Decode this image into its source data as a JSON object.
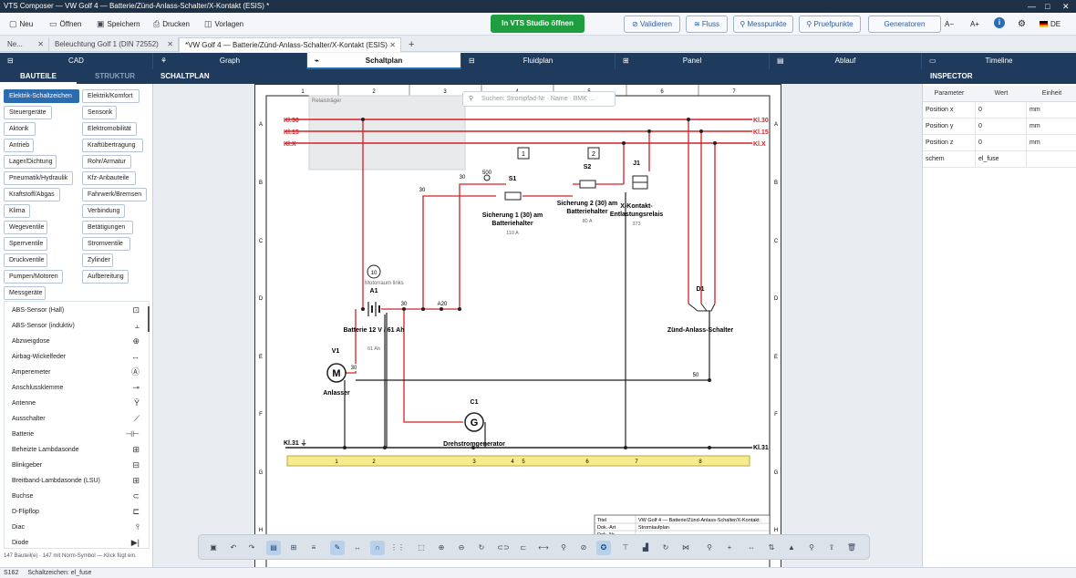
{
  "window": {
    "title": "VTS Composer — VW Golf 4 — Batterie/Zünd-Anlass-Schalter/X-Kontakt (ESIS) *",
    "minimize": "—",
    "maximize": "□",
    "close": "✕"
  },
  "menu": {
    "new_label": "Neu",
    "open_label": "Öffnen",
    "save_label": "Speichern",
    "print_label": "Drucken",
    "templates_label": "Vorlagen",
    "open_in_studio": "In VTS Studio öffnen",
    "validate_label": "Validieren",
    "flow_label": "Fluss",
    "measure_label": "Messpunkte",
    "check_label": "Pruefpunkte",
    "generators_label": "Generatoren",
    "font_down": "A−",
    "font_up": "A+",
    "info": "i",
    "settings": "⚙",
    "language": "DE"
  },
  "doc_tabs": [
    {
      "label": "Ne...",
      "close": "✕"
    },
    {
      "label": "Beleuchtung Golf 1 (DIN 72552)",
      "close": "✕"
    },
    {
      "label": "*VW Golf 4 — Batterie/Zünd-Anlass-Schalter/X-Kontakt (ESIS)",
      "close": "✕"
    },
    {
      "label": "+"
    }
  ],
  "sections": {
    "cad": "CAD",
    "graph": "Graph",
    "schaltplan": "Schaltplan",
    "fluidplan": "Fluidplan",
    "panel": "Panel",
    "ablauf": "Ablauf",
    "timeline": "Timeline"
  },
  "subheader": {
    "bauteile": "BAUTEILE",
    "struktur": "STRUKTUR",
    "schaltplan": "SCHALTPLAN",
    "inspector": "INSPECTOR"
  },
  "categories": [
    "Elektrik-Schaltzeichen",
    "Elektrik/Komfort",
    "Steuergeräte",
    "Sensorik",
    "Aktorik",
    "Elektromobilität",
    "Antrieb",
    "Kraftübertragung",
    "Lager/Dichtung",
    "Rohr/Armatur",
    "Pneumatik/Hydraulik",
    "Kfz-Anbauteile",
    "Kraftstoff/Abgas",
    "Fahrwerk/Bremsen",
    "Klima",
    "Verbindung",
    "Wegeventile",
    "Betätigungen",
    "Sperrventile",
    "Stromventile",
    "Druckventile",
    "Zylinder",
    "Pumpen/Motoren",
    "Aufbereitung",
    "Messgeräte"
  ],
  "components": [
    {
      "name": "ABS-Sensor (Hall)",
      "icon": "abs-hall-icon"
    },
    {
      "name": "ABS-Sensor (induktiv)",
      "icon": "abs-inductive-icon"
    },
    {
      "name": "Abzweigdose",
      "icon": "junction-box-icon"
    },
    {
      "name": "Airbag-Wickelfeder",
      "icon": "clockspring-icon"
    },
    {
      "name": "Amperemeter",
      "icon": "ammeter-icon"
    },
    {
      "name": "Anschlussklemme",
      "icon": "terminal-icon"
    },
    {
      "name": "Antenne",
      "icon": "antenna-icon"
    },
    {
      "name": "Ausschalter",
      "icon": "switch-icon"
    },
    {
      "name": "Batterie",
      "icon": "battery-icon"
    },
    {
      "name": "Beheizte Lambdasonde",
      "icon": "lambda-heated-icon"
    },
    {
      "name": "Blinkgeber",
      "icon": "flasher-icon"
    },
    {
      "name": "Breitband-Lambdasonde (LSU)",
      "icon": "lambda-lsu-icon"
    },
    {
      "name": "Buchse",
      "icon": "socket-icon"
    },
    {
      "name": "D-Flipflop",
      "icon": "flipflop-icon"
    },
    {
      "name": "Diac",
      "icon": "diac-icon"
    },
    {
      "name": "Diode",
      "icon": "diode-icon"
    }
  ],
  "left_footer": "147 Bauteil(e) · 147 mit Norm-Symbol — Klick fügt ein.",
  "search_placeholder": "Suchen: Strompfad-Nr · Name · BMK ...",
  "schematic": {
    "columns": [
      "1",
      "2",
      "3",
      "4",
      "5",
      "6",
      "7"
    ],
    "rows": [
      "A",
      "B",
      "C",
      "D",
      "E",
      "F",
      "G",
      "H"
    ],
    "rails": [
      {
        "label": "Kl.30"
      },
      {
        "label": "Kl.15"
      },
      {
        "label": "Kl.X"
      },
      {
        "label": "Kl.31"
      }
    ],
    "relais_label": "Relaisträger",
    "boxes": [
      "1",
      "2"
    ],
    "wire_labels": [
      "500",
      "30",
      "30",
      "30",
      "A20",
      "30",
      "50"
    ],
    "components": [
      {
        "id": "S1",
        "name": "Sicherung 1 (30) am",
        "name2": "Batteriehalter",
        "rating": "110 A"
      },
      {
        "id": "S2",
        "name": "Sicherung 2 (30) am",
        "name2": "Batteriehalter",
        "rating": "80 A"
      },
      {
        "id": "J1",
        "name": "X-Kontakt-",
        "name2": "Entlastungsrelais",
        "rating": "373"
      },
      {
        "id": "A1",
        "name": "Batterie 12 V / 61 Ah",
        "name2": "",
        "rating": "61 Ah"
      },
      {
        "id": "V1",
        "name": "Anlasser",
        "name2": "",
        "rating": ""
      },
      {
        "id": "C1",
        "name": "Drehstromgenerator",
        "name2": "",
        "rating": ""
      },
      {
        "id": "D1",
        "name": "Zünd-Anlass-Schalter",
        "name2": "",
        "rating": ""
      }
    ],
    "battery_location": {
      "number": "10",
      "text": "Motorraum links"
    },
    "strompfad": [
      "1",
      "2",
      "3",
      "4",
      "5",
      "6",
      "7",
      "8"
    ],
    "titleblock": [
      {
        "key": "Titel",
        "value": "VW Golf 4 — Batterie/Zünd-Anlass-Schalter/X-Kontakt"
      },
      {
        "key": "Dok.-Art",
        "value": "Stromlaufplan"
      },
      {
        "key": "Dok.-Nr",
        "value": ""
      }
    ]
  },
  "inspector": {
    "headers": [
      "Parameter",
      "Wert",
      "Einheit"
    ],
    "rows": [
      {
        "param": "Position x",
        "value": "0",
        "unit": "mm"
      },
      {
        "param": "Position y",
        "value": "0",
        "unit": "mm"
      },
      {
        "param": "Position z",
        "value": "0",
        "unit": "mm"
      },
      {
        "param": "schem",
        "value": "el_fuse",
        "unit": ""
      }
    ]
  },
  "status": {
    "left": "S162",
    "text": "Schaltzeichen: el_fuse"
  },
  "colors": {
    "accent": "#2b6cb0",
    "wire": "#d32027",
    "header": "#1e3a5c",
    "studio": "#1e9e3e",
    "strip": "#f7ec8b"
  }
}
